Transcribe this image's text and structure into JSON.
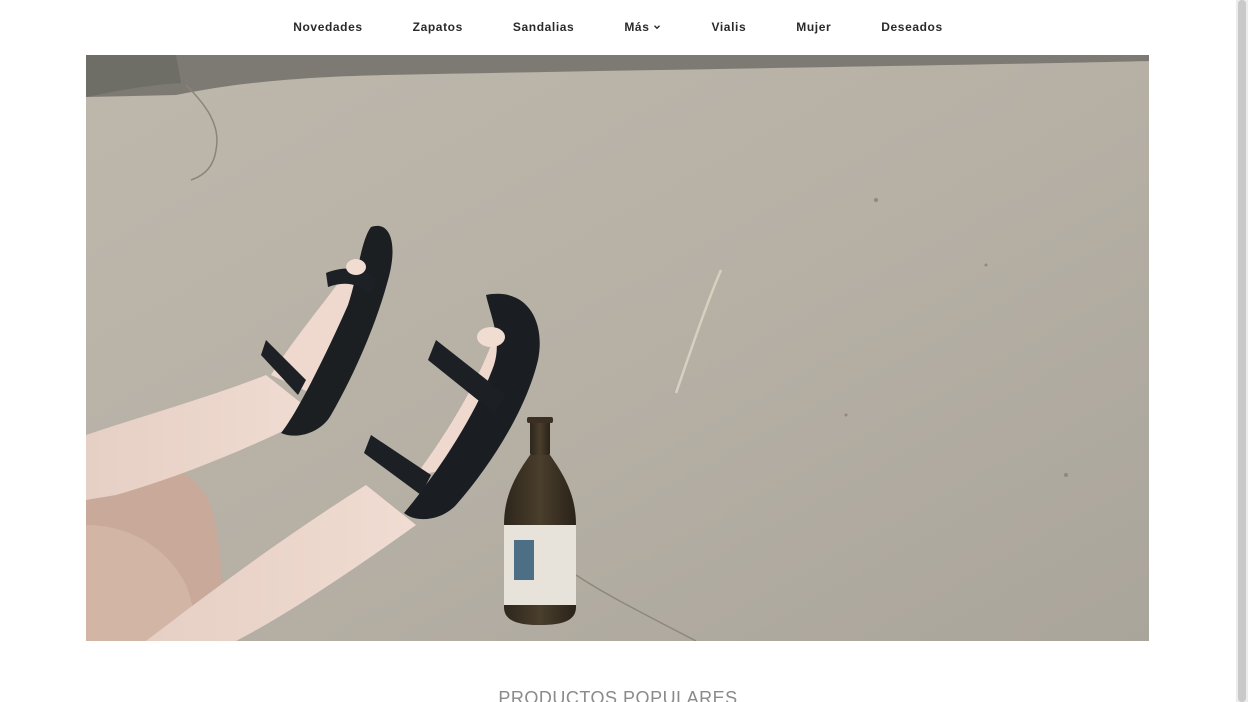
{
  "nav": {
    "items": [
      {
        "label": "Novedades"
      },
      {
        "label": "Zapatos"
      },
      {
        "label": "Sandalias"
      },
      {
        "label": "Más",
        "has_dropdown": true
      },
      {
        "label": "Vialis"
      },
      {
        "label": "Mujer"
      },
      {
        "label": "Deseados"
      }
    ]
  },
  "hero": {
    "image_icon": "hero-photo-sandals-bottle"
  },
  "sections": {
    "popular_title": "PRODUCTOS POPULARES"
  },
  "icons": {
    "dropdown": "chevron-down-icon"
  },
  "colors": {
    "nav_text": "#2a2a2a",
    "section_title": "#8a8a8a",
    "background": "#ffffff"
  }
}
